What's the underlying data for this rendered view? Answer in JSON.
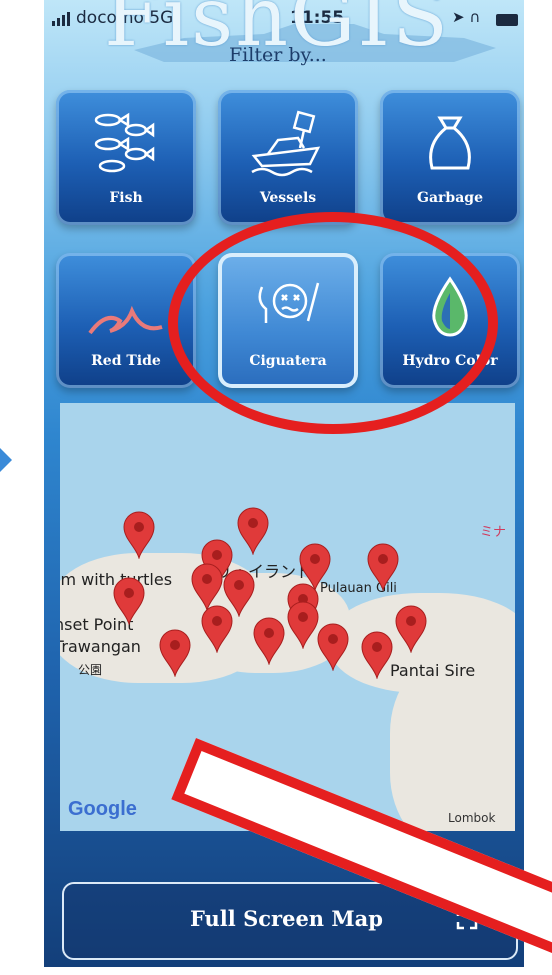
{
  "status_bar": {
    "carrier": "docomo 5G",
    "time": "11:55"
  },
  "header": {
    "app_title": "FishGIS",
    "filter_label": "Filter by..."
  },
  "filters": [
    {
      "label": "Fish",
      "icon": "fish-icon",
      "active": false
    },
    {
      "label": "Vessels",
      "icon": "vessel-icon",
      "active": false
    },
    {
      "label": "Garbage",
      "icon": "garbage-bag-icon",
      "active": false
    },
    {
      "label": "Red Tide",
      "icon": "wave-icon",
      "active": false
    },
    {
      "label": "Ciguatera",
      "icon": "ciguatera-icon",
      "active": true
    },
    {
      "label": "Hydro Color",
      "icon": "water-drop-icon",
      "active": false
    }
  ],
  "map": {
    "labels": [
      "im with turtles",
      "ギリ・イランド",
      "Pulauan Gili",
      "nset Point",
      "Trawangan",
      "公園",
      "ミナ",
      "Pantai Sire",
      "Lombok"
    ],
    "attribution": "Google"
  },
  "footer": {
    "button_label": "Full Screen Map"
  },
  "colors": {
    "highlight": "#e51f1f",
    "tile": "#1d5fb4",
    "pin": "#e03a3a"
  }
}
